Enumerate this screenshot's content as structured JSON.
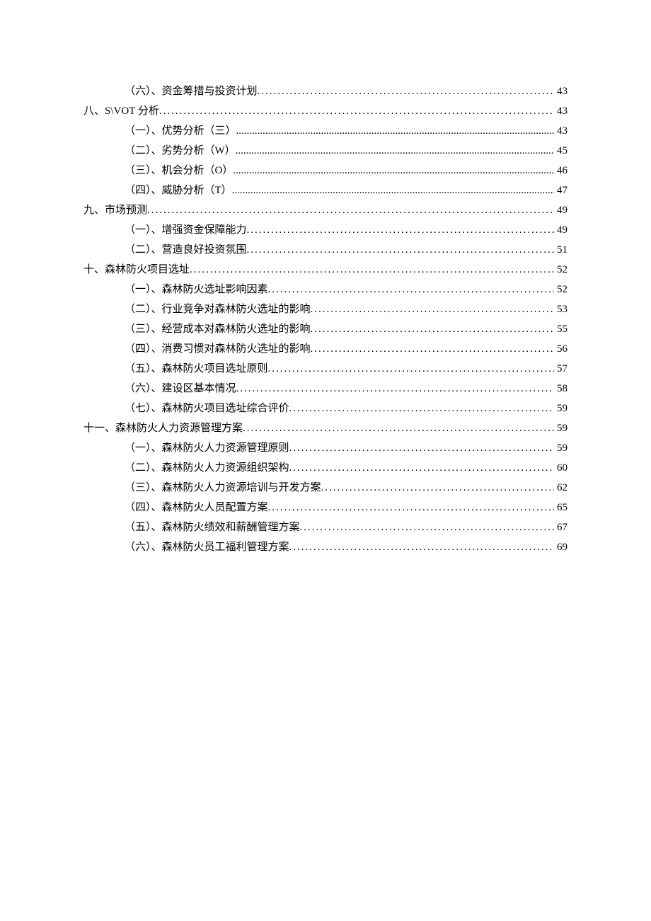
{
  "toc": [
    {
      "level": 2,
      "label": "（六）、资金筹措与投资计划",
      "page": "43",
      "leader": "dots"
    },
    {
      "level": 1,
      "label": "八、S\\VOT 分析",
      "page": "43",
      "leader": "dots"
    },
    {
      "level": 2,
      "label": "（一）、优势分析（三）",
      "page": "43",
      "leader": "dense"
    },
    {
      "level": 2,
      "label": "（二）、劣势分析（W）",
      "page": "45",
      "leader": "dense"
    },
    {
      "level": 2,
      "label": "（三）、机会分析（O）",
      "page": "46",
      "leader": "dense"
    },
    {
      "level": 2,
      "label": "（四）、威胁分析（T）",
      "page": "47",
      "leader": "dense"
    },
    {
      "level": 1,
      "label": "九、市场预测",
      "page": "49",
      "leader": "dots"
    },
    {
      "level": 2,
      "label": "（一）、增强资金保障能力",
      "page": "49",
      "leader": "dots"
    },
    {
      "level": 2,
      "label": "（二）、营造良好投资氛围",
      "page": "51",
      "leader": "dots"
    },
    {
      "level": 1,
      "label": "十、森林防火项目选址",
      "page": "52",
      "leader": "dots"
    },
    {
      "level": 2,
      "label": "（一）、森林防火选址影响因素",
      "page": "52",
      "leader": "dots"
    },
    {
      "level": 2,
      "label": "（二）、行业竞争对森林防火选址的影响",
      "page": "53",
      "leader": "dots"
    },
    {
      "level": 2,
      "label": "（三）、经营成本对森林防火选址的影响",
      "page": "55",
      "leader": "dots"
    },
    {
      "level": 2,
      "label": "（四）、消费习惯对森林防火选址的影响",
      "page": "56",
      "leader": "dots"
    },
    {
      "level": 2,
      "label": "（五）、森林防火项目选址原则",
      "page": "57",
      "leader": "dots"
    },
    {
      "level": 2,
      "label": "（六）、建设区基本情况",
      "page": "58",
      "leader": "dots"
    },
    {
      "level": 2,
      "label": "（七）、森林防火项目选址综合评价",
      "page": "59",
      "leader": "dots"
    },
    {
      "level": 1,
      "label": "十一、森林防火人力资源管理方案",
      "page": "59",
      "leader": "dots"
    },
    {
      "level": 2,
      "label": "（一）、森林防火人力资源管理原则",
      "page": "59",
      "leader": "dots"
    },
    {
      "level": 2,
      "label": "（二）、森林防火人力资源组织架构",
      "page": "60",
      "leader": "dots"
    },
    {
      "level": 2,
      "label": "（三）、森林防火人力资源培训与开发方案",
      "page": "62",
      "leader": "dots"
    },
    {
      "level": 2,
      "label": "（四）、森林防火人员配置方案",
      "page": "65",
      "leader": "dots"
    },
    {
      "level": 2,
      "label": "（五）、森林防火绩效和薪酬管理方案",
      "page": "67",
      "leader": "dots"
    },
    {
      "level": 2,
      "label": "（六）、森林防火员工福利管理方案",
      "page": "69",
      "leader": "dots"
    }
  ]
}
